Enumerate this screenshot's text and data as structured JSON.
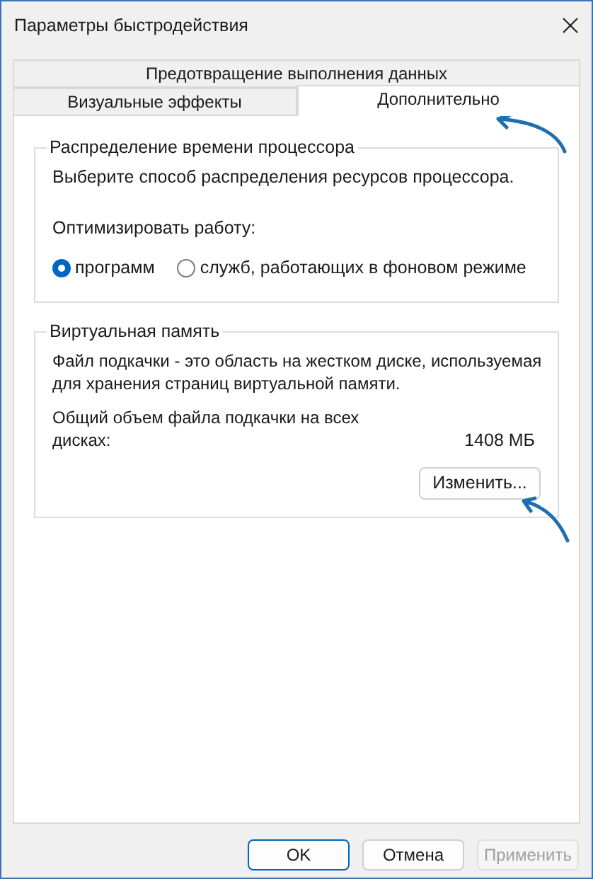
{
  "window": {
    "title": "Параметры быстродействия"
  },
  "tab_rows": [
    [
      {
        "label": "Предотвращение выполнения данных",
        "selected": false
      }
    ],
    [
      {
        "label": "Визуальные эффекты",
        "selected": false
      },
      {
        "label": "Дополнительно",
        "selected": true
      }
    ]
  ],
  "processor_group": {
    "title": "Распределение времени процессора",
    "description": "Выберите способ распределения ресурсов процессора.",
    "optimize_label": "Оптимизировать работу:",
    "radios": [
      {
        "label": "программ",
        "selected": true
      },
      {
        "label": "служб, работающих в фоновом режиме",
        "selected": false
      }
    ]
  },
  "virtual_memory_group": {
    "title": "Виртуальная память",
    "description": "Файл подкачки - это область на жестком диске, используемая для хранения страниц виртуальной памяти.",
    "total_label": "Общий объем файла подкачки на всех дисках:",
    "total_value": "1408 МБ",
    "change_button": "Изменить..."
  },
  "buttons": [
    {
      "label": "OK",
      "default": true,
      "disabled": false
    },
    {
      "label": "Отмена",
      "default": false,
      "disabled": false
    },
    {
      "label": "Применить",
      "default": false,
      "disabled": true
    }
  ]
}
